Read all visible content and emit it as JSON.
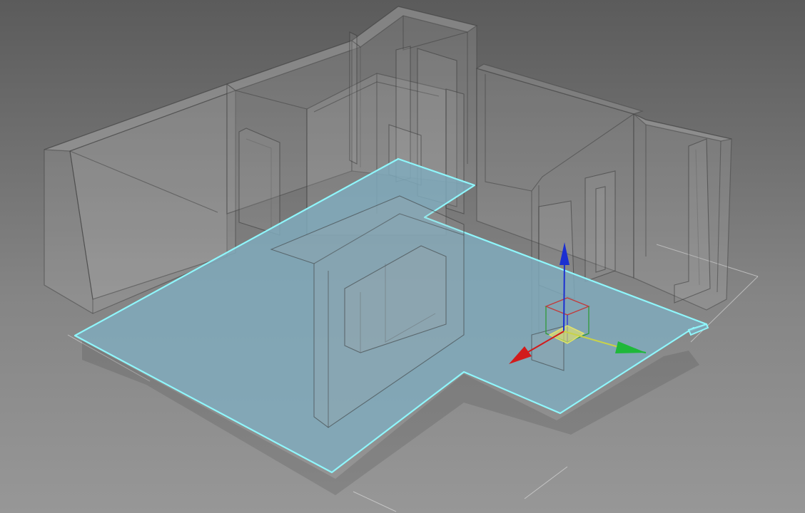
{
  "viewport": {
    "background_top": "#5b5b5b",
    "background_bottom": "#979797"
  },
  "selection": {
    "outline_color": "#8ff6fb",
    "fill_color": "#7fa8b8"
  },
  "gizmo": {
    "x_axis_color": "#d21b1b",
    "y_axis_color": "#1fb83a",
    "z_axis_color": "#1b2fd2",
    "plane_color": "#e3e36b",
    "icon": "move-gizmo-icon"
  }
}
